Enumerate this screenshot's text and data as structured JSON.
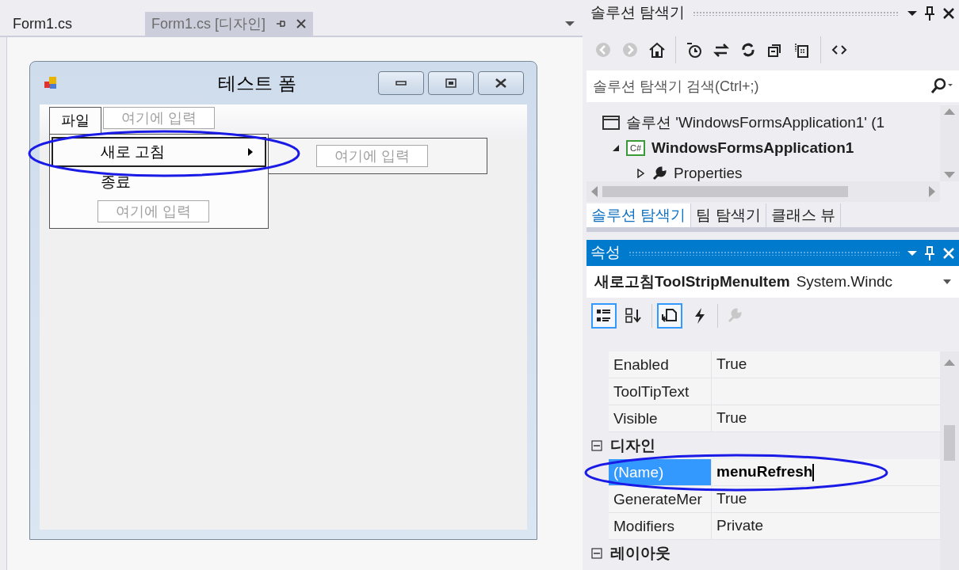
{
  "editor_tabs": [
    {
      "label": "Form1.cs",
      "selected": false
    },
    {
      "label": "Form1.cs [디자인]",
      "selected": true
    }
  ],
  "form": {
    "title": "테스트 폼",
    "menu_bar": [
      {
        "kind": "menu",
        "label": "파일",
        "selected": true
      },
      {
        "kind": "placeholder",
        "label": "여기에 입력"
      }
    ],
    "dropdown": [
      {
        "kind": "item",
        "label": "새로 고침",
        "selected": true,
        "has_submenu": true
      },
      {
        "kind": "item",
        "label": "종료",
        "selected": false,
        "has_submenu": false
      },
      {
        "kind": "placeholder",
        "label": "여기에 입력"
      }
    ],
    "submenu": [
      {
        "kind": "placeholder",
        "label": "여기에 입력"
      }
    ]
  },
  "solution_explorer": {
    "title": "솔루션 탐색기",
    "search": {
      "placeholder": "솔루션 탐색기 검색(Ctrl+;)"
    },
    "tree": [
      {
        "kind": "solution",
        "label": "솔루션 'WindowsFormsApplication1' (1",
        "children": [
          {
            "kind": "project",
            "icon_label": "C#",
            "label": "WindowsFormsApplication1",
            "expanded": true,
            "children": [
              {
                "kind": "properties",
                "label": "Properties",
                "expanded": false
              }
            ]
          }
        ]
      }
    ],
    "tabs": [
      {
        "label": "솔루션 탐색기",
        "selected": true
      },
      {
        "label": "팀 탐색기",
        "selected": false
      },
      {
        "label": "클래스 뷰",
        "selected": false
      }
    ]
  },
  "properties": {
    "title": "속성",
    "object_name": "새로고침ToolStripMenuItem",
    "object_type": "System.Windc",
    "toolbar": [
      {
        "kind": "categorized",
        "selected": true
      },
      {
        "kind": "alphabetical",
        "selected": false
      },
      {
        "kind": "properties",
        "selected": true
      },
      {
        "kind": "events",
        "selected": false
      },
      {
        "kind": "property-pages",
        "selected": false
      }
    ],
    "rows": [
      {
        "kind": "property",
        "name": "Enabled",
        "value": "True",
        "selected": false
      },
      {
        "kind": "property",
        "name": "ToolTipText",
        "value": "",
        "selected": false
      },
      {
        "kind": "property",
        "name": "Visible",
        "value": "True",
        "selected": false
      },
      {
        "kind": "category",
        "name": "디자인",
        "expanded": true
      },
      {
        "kind": "property",
        "name": "(Name)",
        "value": "menuRefresh",
        "selected": true
      },
      {
        "kind": "property",
        "name": "GenerateMer",
        "value": "True",
        "selected": false
      },
      {
        "kind": "property",
        "name": "Modifiers",
        "value": "Private",
        "selected": false
      },
      {
        "kind": "category",
        "name": "레이아웃",
        "expanded": true
      }
    ]
  }
}
